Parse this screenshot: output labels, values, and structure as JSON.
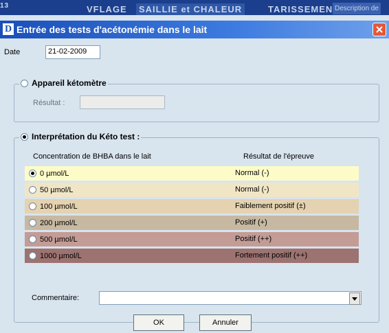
{
  "background_tabs": [
    "13",
    "VFLAGE",
    "SAILLIE et CHALEUR",
    "TARISSEMENT",
    "Description de"
  ],
  "dialog": {
    "title": "Entrée des tests d'acétonémie dans le lait",
    "app_icon": "D"
  },
  "date": {
    "label": "Date",
    "value": "21-02-2009"
  },
  "ketometre": {
    "option_label": "Appareil kétomètre",
    "selected": false,
    "result_label": "Résultat :",
    "result_value": ""
  },
  "keto_test": {
    "option_label": "Interprétation du Kéto test :",
    "selected": true,
    "col_concentration": "Concentration de BHBA dans le lait",
    "col_result": "Résultat de l'épreuve",
    "rows": [
      {
        "concentration": "0 µmol/L",
        "result": "Normal (-)",
        "color": "#fdfcc8",
        "selected": true
      },
      {
        "concentration": "50 µmol/L",
        "result": "Normal (-)",
        "color": "#f0e6c6",
        "selected": false
      },
      {
        "concentration": "100 µmol/L",
        "result": "Faiblement positif (±)",
        "color": "#e4d2b0",
        "selected": false
      },
      {
        "concentration": "200  µmol/L",
        "result": "Positif (+)",
        "color": "#c7b8a2",
        "selected": false
      },
      {
        "concentration": "500  µmol/L",
        "result": "Positif (++)",
        "color": "#c39c96",
        "selected": false
      },
      {
        "concentration": "1000 µmol/L",
        "result": "Fortement positif (++)",
        "color": "#9c7370",
        "selected": false
      }
    ]
  },
  "comment": {
    "label": "Commentaire:",
    "value": ""
  },
  "buttons": {
    "ok": "OK",
    "cancel": "Annuler"
  },
  "colors": {
    "titlebar": "#1a4fb8",
    "dialog_bg": "#d8e4ee",
    "close": "#e2593a"
  }
}
